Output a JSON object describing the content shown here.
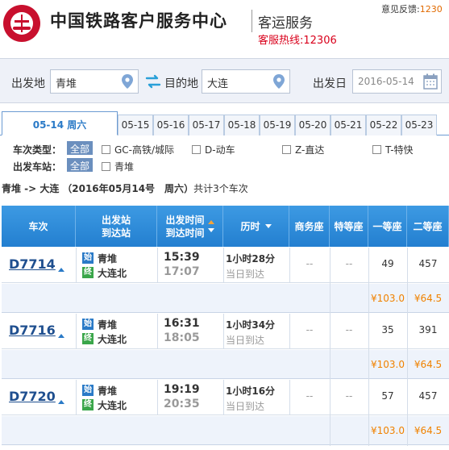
{
  "header": {
    "brand_title": "中国铁路客户服务中心",
    "brand_sub": "客运服务",
    "hotline": "客服热线:12306",
    "feedback_label": "意见反馈:",
    "feedback_value": "1230"
  },
  "search": {
    "from_label": "出发地",
    "from_value": "青堆",
    "to_label": "目的地",
    "to_value": "大连",
    "date_label": "出发日",
    "date_value": "2016-05-14"
  },
  "tabs": {
    "active": "05-14 周六",
    "dates": [
      "05-15",
      "05-16",
      "05-17",
      "05-18",
      "05-19",
      "05-20",
      "05-21",
      "05-22",
      "05-23"
    ]
  },
  "filters": {
    "type_label": "车次类型：",
    "all": "全部",
    "types": [
      "GC-高铁/城际",
      "D-动车",
      "Z-直达",
      "T-特快"
    ],
    "station_label": "出发车站：",
    "stations": [
      "青堆"
    ]
  },
  "summary": {
    "route": "青堆 -> 大连",
    "date": "2016年05月14号　周六",
    "count": "共计3个车次"
  },
  "table": {
    "headers": {
      "train": "车次",
      "station_a": "出发站",
      "station_b": "到达站",
      "time_a": "出发时间",
      "time_b": "到达时间",
      "duration": "历时",
      "business": "商务座",
      "special": "特等座",
      "first": "一等座",
      "second": "二等座"
    },
    "rows": [
      {
        "train": "D7714",
        "from_icon": "始",
        "from": "青堆",
        "to_icon": "终",
        "to": "大连北",
        "dep": "15:39",
        "arr": "17:07",
        "duration": "1小时28分",
        "arrive_note": "当日到达",
        "business": "--",
        "special": "--",
        "first": "49",
        "second": "457",
        "first_price": "¥103.0",
        "second_price": "¥64.5"
      },
      {
        "train": "D7716",
        "from_icon": "始",
        "from": "青堆",
        "to_icon": "终",
        "to": "大连北",
        "dep": "16:31",
        "arr": "18:05",
        "duration": "1小时34分",
        "arrive_note": "当日到达",
        "business": "--",
        "special": "--",
        "first": "35",
        "second": "391",
        "first_price": "¥103.0",
        "second_price": "¥64.5"
      },
      {
        "train": "D7720",
        "from_icon": "始",
        "from": "青堆",
        "to_icon": "终",
        "to": "大连北",
        "dep": "19:19",
        "arr": "20:35",
        "duration": "1小时16分",
        "arrive_note": "当日到达",
        "business": "--",
        "special": "--",
        "first": "57",
        "second": "457",
        "first_price": "¥103.0",
        "second_price": "¥64.5"
      }
    ]
  },
  "colors": {
    "brand_red": "#c8102e",
    "table_header": "#237fd0",
    "price_orange": "#f08200",
    "link_blue": "#1f4f8f"
  }
}
